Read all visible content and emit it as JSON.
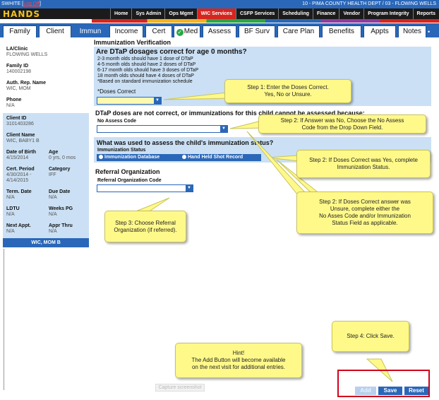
{
  "topbar": {
    "user": "SWHITE",
    "logoff": "Log Off",
    "agency": "10 - PIMA COUNTY HEALTH DEPT / 03 - FLOWING WELLS"
  },
  "logo": "HANDS",
  "menu": [
    "Home",
    "Sys Admin",
    "Ops Mgmt",
    "WIC Services",
    "CSFP Services",
    "Scheduling",
    "Finance",
    "Vendor",
    "Program Integrity",
    "Reports"
  ],
  "menu_active": "WIC Services",
  "tabs": [
    "Family",
    "Client",
    "Immun",
    "Income",
    "Cert",
    "Med",
    "Assess",
    "BF Surv",
    "Care Plan",
    "Benefits",
    "Appts",
    "Notes"
  ],
  "tab_active": "Immun",
  "left": {
    "la_clinic_label": "LA/Clinic",
    "la_clinic": "FLOWING WELLS",
    "family_id_label": "Family ID",
    "family_id": "140002198",
    "auth_rep_label": "Auth. Rep. Name",
    "auth_rep": "WIC, MOM",
    "phone_label": "Phone",
    "phone": "N/A",
    "client_id_label": "Client ID",
    "client_id": "3101403286",
    "client_name_label": "Client Name",
    "client_name": "WIC, BABY1 B",
    "dob_label": "Date of Birth",
    "dob": "4/15/2014",
    "age_label": "Age",
    "age": "0 yrs, 0 mos",
    "cert_period_label": "Cert. Period",
    "cert_period_1": "4/30/2014 -",
    "cert_period_2": "4/14/2015",
    "category_label": "Category",
    "category": "IFF",
    "term_date_label": "Term. Date",
    "term_date": "N/A",
    "due_date_label": "Due Date",
    "due_date": "N/A",
    "ldtu_label": "LDTU",
    "ldtu": "N/A",
    "weeks_pg_label": "Weeks PG",
    "weeks_pg": "N/A",
    "next_appt_label": "Next Appt.",
    "next_appt": "N/A",
    "appr_thru_label": "Appr Thru",
    "appr_thru": "N/A",
    "footer": "WIC, MOM B"
  },
  "main": {
    "page_heading": "Immunization Verification",
    "q1": "Are DTaP dosages correct for age 0 months?",
    "rules": [
      "2-3 month olds should have 1 dose of DTaP",
      "4-5 month olds should have 2 doses of DTaP",
      "6-17 month olds should have 3 doses of DTaP",
      "18 month olds should have 4 doses of DTaP",
      "*Based on standard immunization schedule"
    ],
    "doses_label": "*Doses Correct",
    "q2": "DTaP doses are not correct, or immunizations for this child cannot be assessed because:",
    "no_assess_label": "No Assess Code",
    "q3": "What was used to assess the child's immunization status?",
    "imm_status_label": "Immunization Status",
    "opt1": "Immunization Database",
    "opt2": "Hand Held Shot Record",
    "referral_heading": "Referral Organization",
    "referral_label": "Referral Organization Code"
  },
  "callouts": {
    "step1": "Step 1: Enter the Doses Correct.\nYes, No or Unsure.",
    "step2a": "Step 2: If Answer was No, Choose the No Assess\nCode from the Drop Down Field.",
    "step2b": "Step 2: If Doses Correct was Yes, complete\nImmunization Status.",
    "step2c": "Step 2: If Doses Correct answer was\nUnsure, complete either the\nNo Asses Code and/or Immunization\nStatus Field as applicable.",
    "step3": "Step 3: Choose Referral\nOrganization (if referred).",
    "step4": "Step 4: Click Save.",
    "hint": "Hint!\nThe Add Button will become available\non the next visit for additional entries."
  },
  "buttons": {
    "add": "Add",
    "save": "Save",
    "reset": "Reset"
  },
  "capture": "Capture screenshot",
  "colors": {
    "blue": "#2a67b8",
    "light_blue": "#cbe0f4",
    "red": "#d6251e",
    "callout": "#fff98a",
    "dose_field": "#fff9b0"
  }
}
